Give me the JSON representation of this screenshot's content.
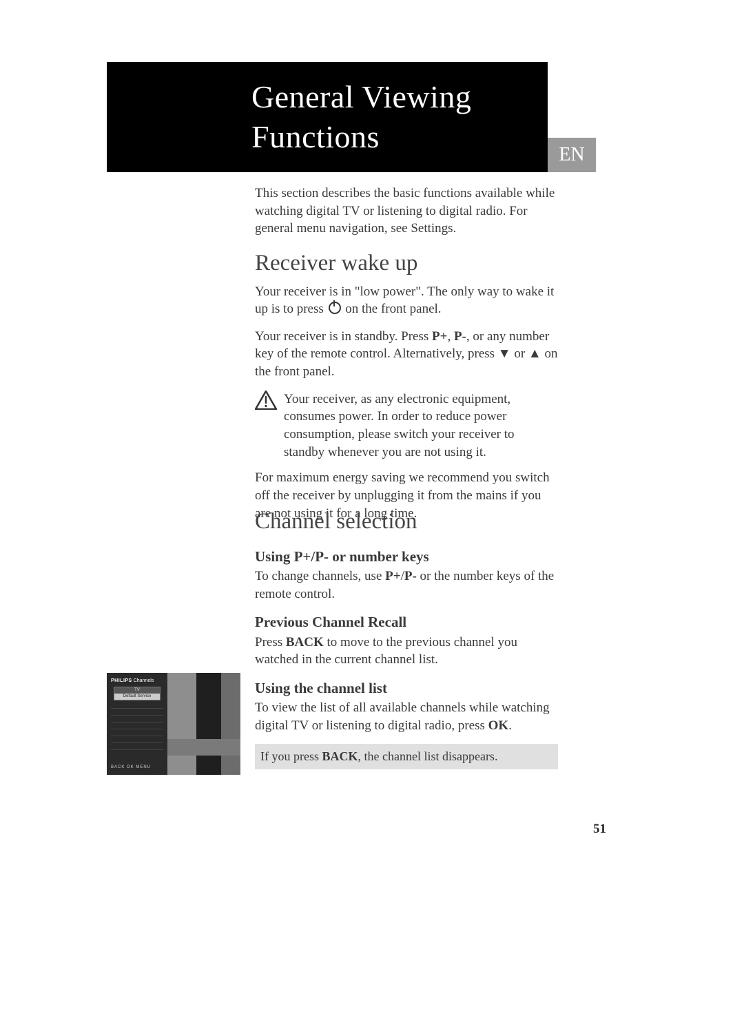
{
  "title": "General Viewing Functions",
  "lang_tab": "EN",
  "intro": "This section describes the basic functions available while watching digital TV or listening to digital radio. For general menu navigation, see Settings.",
  "section1": {
    "heading": "Receiver wake up",
    "p1a": "Your receiver is in \"low power\". The only way to wake it up is to press ",
    "p1b": " on the front panel.",
    "p2a": "Your receiver is in standby. Press ",
    "p2_pplus": "P+",
    "p2_comma1": ", ",
    "p2_pminus": "P-",
    "p2b": ", or any number key of the remote control. Alternatively, press  ▼  or  ▲ on the front panel.",
    "warn": "Your receiver, as any electronic equipment, consumes power. In order to reduce power consumption, please switch your receiver to standby whenever you are not using it.",
    "p3": "For maximum energy saving we recommend you switch off the receiver by unplugging it from the mains if you are not using it for a long time."
  },
  "section2": {
    "heading": "Channel selection",
    "sub1": "Using P+/P- or number keys",
    "sub1_p_a": "To change channels, use ",
    "sub1_b1": "P+",
    "sub1_slash": "/",
    "sub1_b2": "P-",
    "sub1_p_b": " or the number keys of the remote control.",
    "sub2": "Previous Channel Recall",
    "sub2_p_a": "Press ",
    "sub2_back": "BACK",
    "sub2_p_b": " to move to the previous channel you watched in the current channel list.",
    "sub3": "Using the channel list",
    "sub3_p_a": "To view the list of all available channels while watching digital TV or listening to digital radio, press ",
    "sub3_ok": "OK",
    "sub3_p_b": ".",
    "note_a": "If you press ",
    "note_back": "BACK",
    "note_b": ", the channel list disappears."
  },
  "screenshot": {
    "brand": "PHILIPS",
    "brand_sub": "Channels",
    "tab_top": "TV",
    "tab_sel": "Default Service",
    "footer": "BACK    OK    MENU"
  },
  "page_number": "51"
}
